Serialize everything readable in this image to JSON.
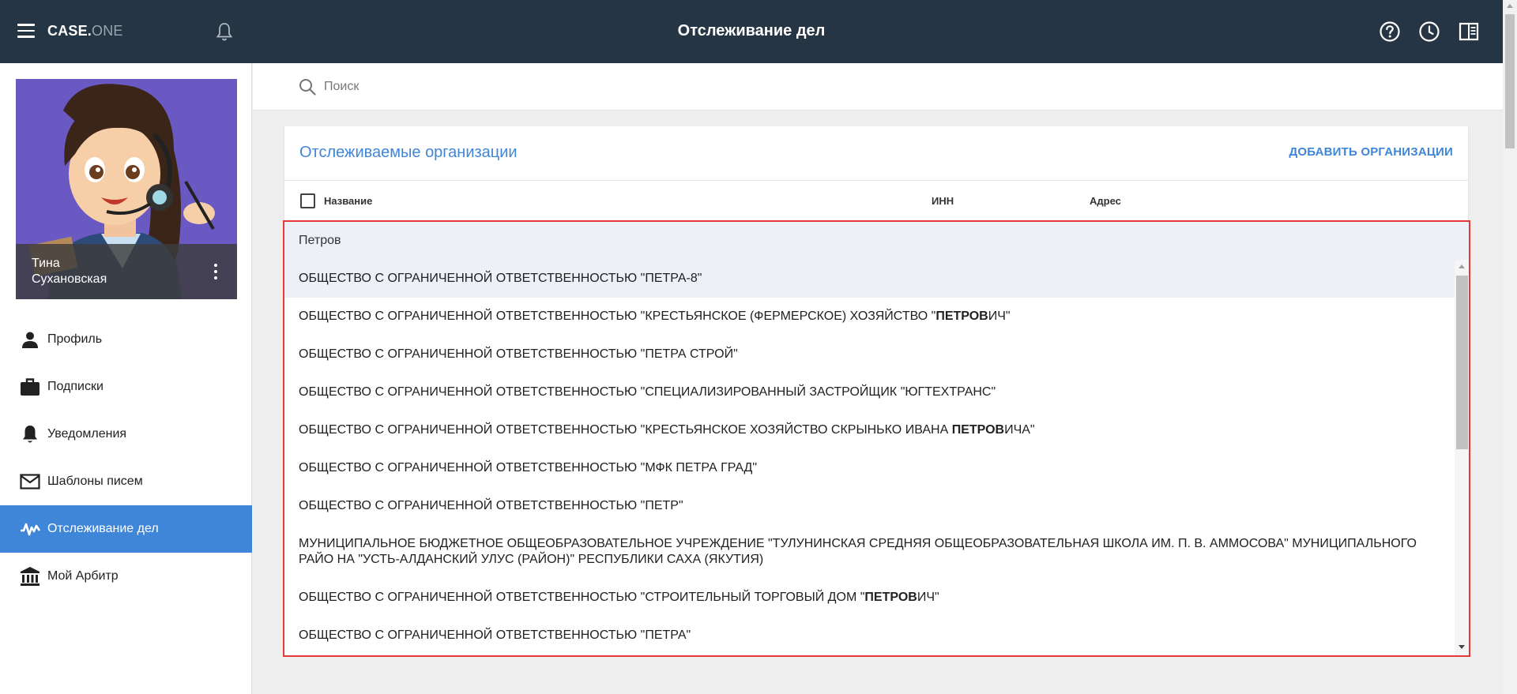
{
  "app": {
    "brand_primary": "CASE.",
    "brand_secondary": "ONE",
    "title": "Отслеживание дел",
    "icons": [
      "menu-icon",
      "bell-icon",
      "help-icon",
      "history-icon",
      "panel-icon"
    ]
  },
  "user": {
    "first_name": "Тина",
    "last_name": "Сухановская"
  },
  "nav": {
    "items": [
      {
        "label": "Профиль",
        "icon": "person-icon",
        "active": false
      },
      {
        "label": "Подписки",
        "icon": "briefcase-icon",
        "active": false
      },
      {
        "label": "Уведомления",
        "icon": "bell-icon",
        "active": false
      },
      {
        "label": "Шаблоны писем",
        "icon": "mail-icon",
        "active": false
      },
      {
        "label": "Отслеживание дел",
        "icon": "activity-icon",
        "active": true
      },
      {
        "label": "Мой Арбитр",
        "icon": "court-icon",
        "active": false
      }
    ]
  },
  "search": {
    "placeholder": "Поиск",
    "value": ""
  },
  "card": {
    "title": "Отслеживаемые организации",
    "add_label": "ДОБАВИТЬ ОРГАНИЗАЦИИ",
    "columns": {
      "name": "Название",
      "inn": "ИНН",
      "address": "Адрес"
    }
  },
  "autocomplete": {
    "query": "Петров",
    "items": [
      {
        "pre": "ОБЩЕСТВО С ОГРАНИЧЕННОЙ ОТВЕТСТВЕННОСТЬЮ \"ПЕТРА-8\"",
        "bold": "",
        "post": ""
      },
      {
        "pre": "ОБЩЕСТВО С ОГРАНИЧЕННОЙ ОТВЕТСТВЕННОСТЬЮ \"КРЕСТЬЯНСКОЕ (ФЕРМЕРСКОЕ) ХОЗЯЙСТВО \"",
        "bold": "ПЕТРОВ",
        "post": "ИЧ\""
      },
      {
        "pre": "ОБЩЕСТВО С ОГРАНИЧЕННОЙ ОТВЕТСТВЕННОСТЬЮ \"ПЕТРА СТРОЙ\"",
        "bold": "",
        "post": ""
      },
      {
        "pre": "ОБЩЕСТВО С ОГРАНИЧЕННОЙ ОТВЕТСТВЕННОСТЬЮ \"СПЕЦИАЛИЗИРОВАННЫЙ ЗАСТРОЙЩИК \"ЮГТЕХТРАНС\"",
        "bold": "",
        "post": ""
      },
      {
        "pre": "ОБЩЕСТВО С ОГРАНИЧЕННОЙ ОТВЕТСТВЕННОСТЬЮ \"КРЕСТЬЯНСКОЕ ХОЗЯЙСТВО СКРЫНЬКО ИВАНА ",
        "bold": "ПЕТРОВ",
        "post": "ИЧА\""
      },
      {
        "pre": "ОБЩЕСТВО С ОГРАНИЧЕННОЙ ОТВЕТСТВЕННОСТЬЮ \"МФК ПЕТРА ГРАД\"",
        "bold": "",
        "post": ""
      },
      {
        "pre": "ОБЩЕСТВО С ОГРАНИЧЕННОЙ ОТВЕТСТВЕННОСТЬЮ \"ПЕТР\"",
        "bold": "",
        "post": ""
      },
      {
        "pre": "МУНИЦИПАЛЬНОЕ БЮДЖЕТНОЕ ОБЩЕОБРАЗОВАТЕЛЬНОЕ УЧРЕЖДЕНИЕ \"ТУЛУНИНСКАЯ СРЕДНЯЯ ОБЩЕОБРАЗОВАТЕЛЬНАЯ ШКОЛА ИМ. П. В. АММОСОВА\" МУНИЦИПАЛЬНОГО РАЙО НА \"УСТЬ-АЛДАНСКИЙ УЛУС (РАЙОН)\" РЕСПУБЛИКИ САХА (ЯКУТИЯ)",
        "bold": "",
        "post": ""
      },
      {
        "pre": "ОБЩЕСТВО С ОГРАНИЧЕННОЙ ОТВЕТСТВЕННОСТЬЮ \"СТРОИТЕЛЬНЫЙ ТОРГОВЫЙ ДОМ \"",
        "bold": "ПЕТРОВ",
        "post": "ИЧ\""
      },
      {
        "pre": "ОБЩЕСТВО С ОГРАНИЧЕННОЙ ОТВЕТСТВЕННОСТЬЮ \"ПЕТРА\"",
        "bold": "",
        "post": ""
      }
    ]
  },
  "colors": {
    "topbar": "#263544",
    "accent": "#3f86d8",
    "highlight_border": "#e53935",
    "avatar_bg": "#6a59c2"
  }
}
